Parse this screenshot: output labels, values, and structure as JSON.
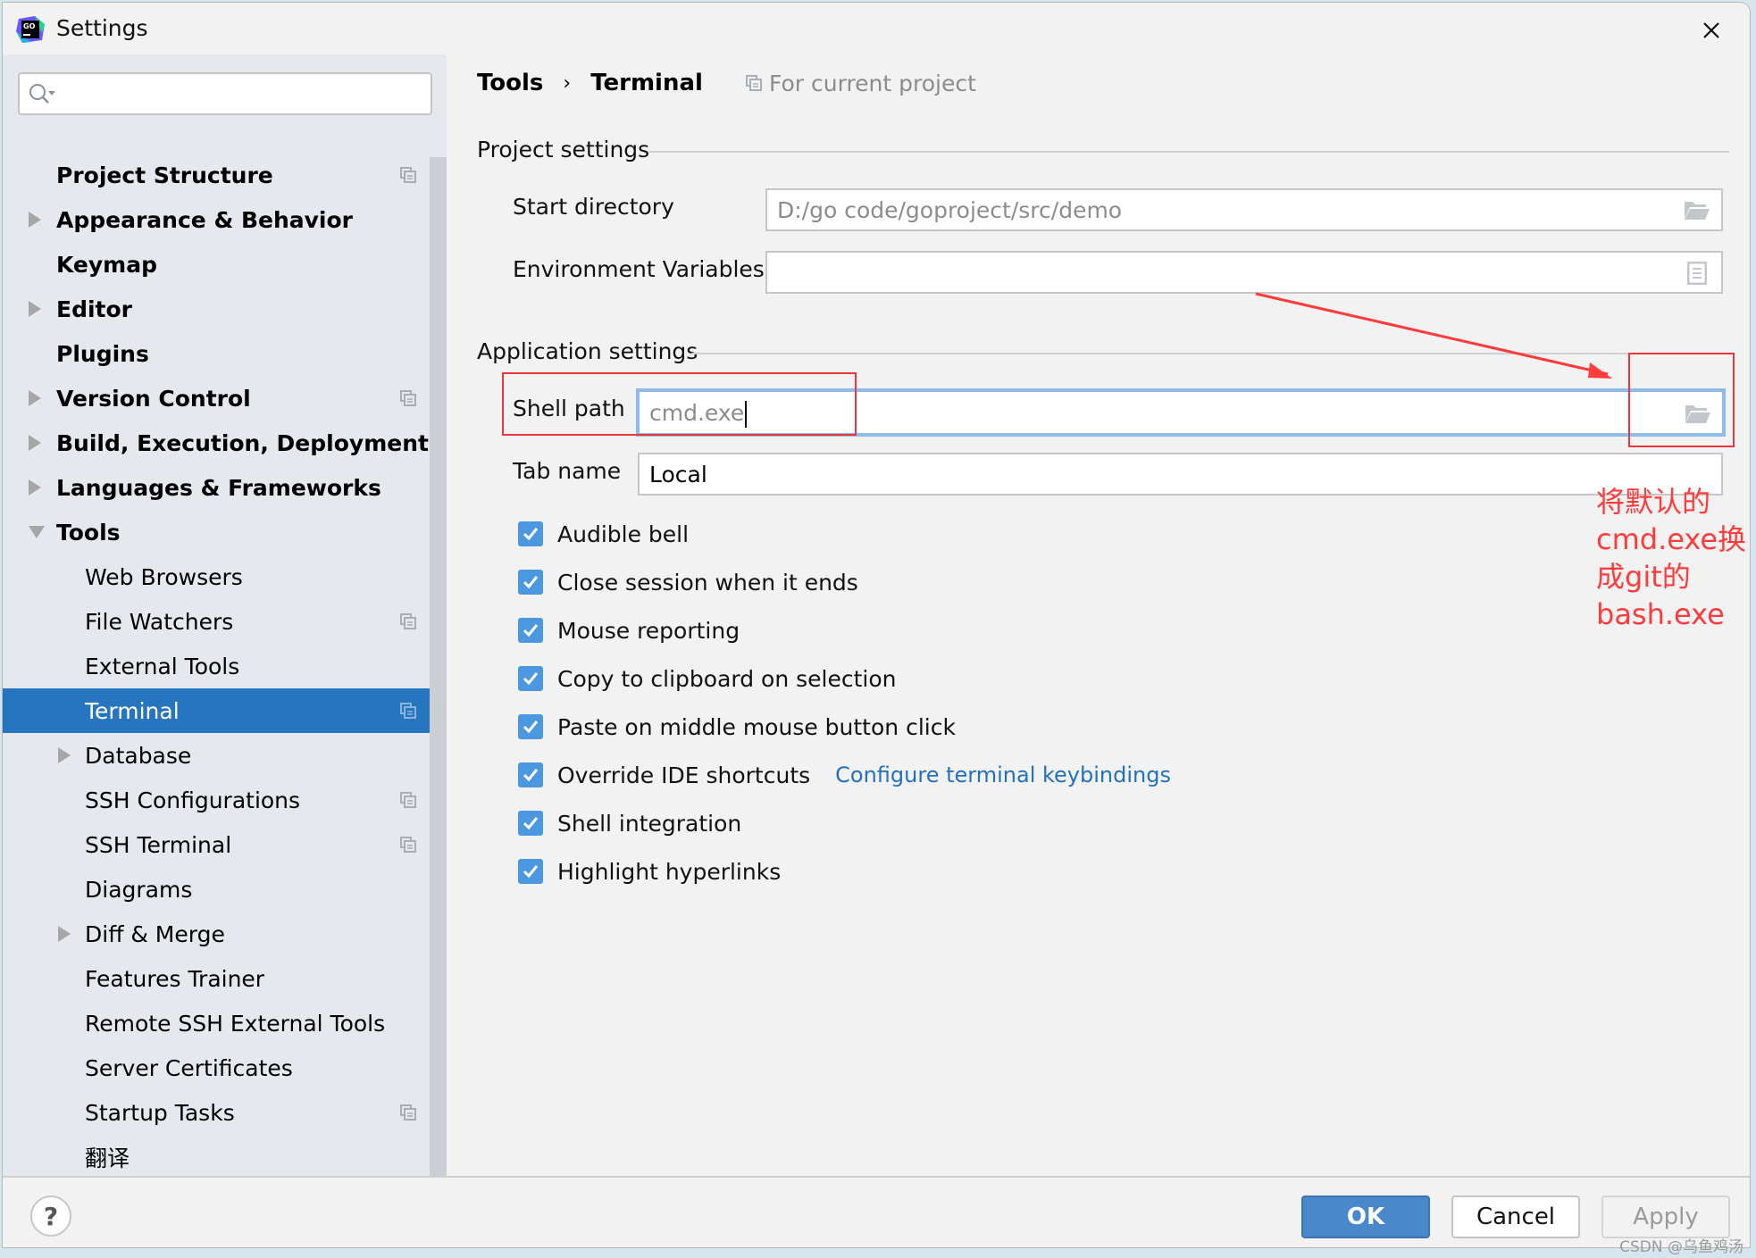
{
  "window": {
    "title": "Settings",
    "app_icon": "goland-logo-icon",
    "close_icon": "close-icon"
  },
  "sidebar": {
    "search": {
      "value": "",
      "placeholder": ""
    },
    "items": [
      {
        "label": "Project Structure",
        "level": 0,
        "expandable": false,
        "project_scope": true
      },
      {
        "label": "Appearance & Behavior",
        "level": 0,
        "expandable": true,
        "expanded": false,
        "project_scope": false
      },
      {
        "label": "Keymap",
        "level": 0,
        "expandable": false,
        "project_scope": false
      },
      {
        "label": "Editor",
        "level": 0,
        "expandable": true,
        "expanded": false,
        "project_scope": false
      },
      {
        "label": "Plugins",
        "level": 0,
        "expandable": false,
        "project_scope": false
      },
      {
        "label": "Version Control",
        "level": 0,
        "expandable": true,
        "expanded": false,
        "project_scope": true
      },
      {
        "label": "Build, Execution, Deployment",
        "level": 0,
        "expandable": true,
        "expanded": false,
        "project_scope": false
      },
      {
        "label": "Languages & Frameworks",
        "level": 0,
        "expandable": true,
        "expanded": false,
        "project_scope": false
      },
      {
        "label": "Tools",
        "level": 0,
        "expandable": true,
        "expanded": true,
        "project_scope": false
      },
      {
        "label": "Web Browsers",
        "level": 1,
        "expandable": false,
        "project_scope": false
      },
      {
        "label": "File Watchers",
        "level": 1,
        "expandable": false,
        "project_scope": true
      },
      {
        "label": "External Tools",
        "level": 1,
        "expandable": false,
        "project_scope": false
      },
      {
        "label": "Terminal",
        "level": 1,
        "expandable": false,
        "project_scope": true,
        "selected": true
      },
      {
        "label": "Database",
        "level": 1,
        "expandable": true,
        "expanded": false,
        "project_scope": false
      },
      {
        "label": "SSH Configurations",
        "level": 1,
        "expandable": false,
        "project_scope": true
      },
      {
        "label": "SSH Terminal",
        "level": 1,
        "expandable": false,
        "project_scope": true
      },
      {
        "label": "Diagrams",
        "level": 1,
        "expandable": false,
        "project_scope": false
      },
      {
        "label": "Diff & Merge",
        "level": 1,
        "expandable": true,
        "expanded": false,
        "project_scope": false
      },
      {
        "label": "Features Trainer",
        "level": 1,
        "expandable": false,
        "project_scope": false
      },
      {
        "label": "Remote SSH External Tools",
        "level": 1,
        "expandable": false,
        "project_scope": false
      },
      {
        "label": "Server Certificates",
        "level": 1,
        "expandable": false,
        "project_scope": false
      },
      {
        "label": "Startup Tasks",
        "level": 1,
        "expandable": false,
        "project_scope": true
      },
      {
        "label": "翻译",
        "level": 1,
        "expandable": false,
        "project_scope": false
      }
    ]
  },
  "main": {
    "breadcrumb": [
      "Tools",
      "Terminal"
    ],
    "breadcrumb_separator": "›",
    "scope_label": "For current project",
    "project_settings": {
      "title": "Project settings",
      "start_directory": {
        "label": "Start directory",
        "value": "D:/go code/goproject/src/demo"
      },
      "env_vars": {
        "label": "Environment Variables",
        "value": ""
      }
    },
    "application_settings": {
      "title": "Application settings",
      "shell_path": {
        "label": "Shell path",
        "value": "cmd.exe"
      },
      "tab_name": {
        "label": "Tab name",
        "value": "Local"
      }
    },
    "checkboxes": [
      {
        "label": "Audible bell",
        "checked": true
      },
      {
        "label": "Close session when it ends",
        "checked": true
      },
      {
        "label": "Mouse reporting",
        "checked": true
      },
      {
        "label": "Copy to clipboard on selection",
        "checked": true
      },
      {
        "label": "Paste on middle mouse button click",
        "checked": true
      },
      {
        "label": "Override IDE shortcuts",
        "checked": true,
        "link": "Configure terminal keybindings"
      },
      {
        "label": "Shell integration",
        "checked": true
      },
      {
        "label": "Highlight hyperlinks",
        "checked": true
      }
    ]
  },
  "annotation": {
    "text": "将默认的cmd.exe换成git的bash.exe",
    "color": "#ff3b3b"
  },
  "footer": {
    "help_label": "?",
    "ok_label": "OK",
    "cancel_label": "Cancel",
    "apply_label": "Apply"
  },
  "watermark": "CSDN @乌鱼鸡汤",
  "colors": {
    "accent": "#2675bf",
    "checkbox": "#4b98e0",
    "link": "#2470c0",
    "ok_button": "#4a88cc",
    "sidebar_bg": "#e5e9ee",
    "window_bg": "#f2f2f2"
  }
}
